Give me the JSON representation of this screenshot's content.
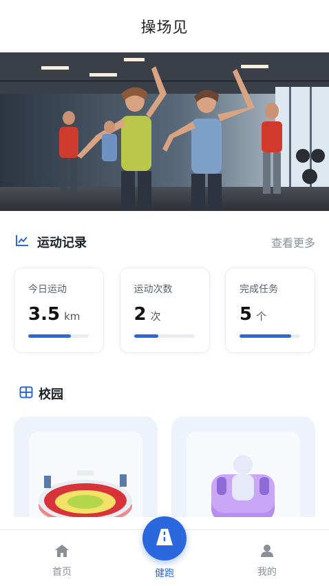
{
  "header": {
    "title": "操场见"
  },
  "banner": {
    "image_desc": "group-fitness-class-photo"
  },
  "records": {
    "title": "运动记录",
    "more_label": "查看更多",
    "icon": "chart-line-icon",
    "cards": [
      {
        "label": "今日运动",
        "value": "3.5",
        "unit": "km",
        "progress": 0.7
      },
      {
        "label": "运动次数",
        "value": "2",
        "unit": "次",
        "progress": 0.4
      },
      {
        "label": "完成任务",
        "value": "5",
        "unit": "个",
        "progress": 0.85
      }
    ]
  },
  "campus": {
    "title": "校园",
    "icon": "grid-icon",
    "items": [
      {
        "icon": "stadium-icon"
      },
      {
        "icon": "fitness-figure-icon"
      }
    ]
  },
  "tabbar": {
    "items": [
      {
        "label": "首页",
        "icon": "home-icon"
      },
      {
        "label": "健跑",
        "icon": "road-icon"
      },
      {
        "label": "我的",
        "icon": "user-icon"
      }
    ],
    "active_index": 1
  },
  "colors": {
    "accent": "#2b67dd",
    "muted": "#8a8f97",
    "card_bg": "#eef3fb"
  }
}
